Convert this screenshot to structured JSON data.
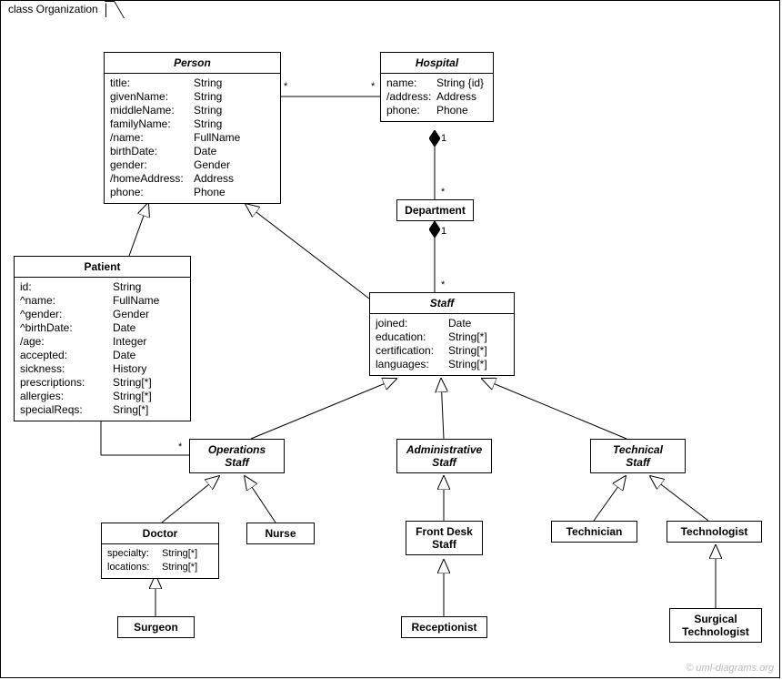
{
  "frameTitle": "class Organization",
  "watermark": "© uml-diagrams.org",
  "classes": {
    "person": {
      "title": "Person",
      "attrs": [
        {
          "n": "title:",
          "t": "String"
        },
        {
          "n": "givenName:",
          "t": "String"
        },
        {
          "n": "middleName:",
          "t": "String"
        },
        {
          "n": "familyName:",
          "t": "String"
        },
        {
          "n": "/name:",
          "t": "FullName"
        },
        {
          "n": "birthDate:",
          "t": "Date"
        },
        {
          "n": "gender:",
          "t": "Gender"
        },
        {
          "n": "/homeAddress:",
          "t": "Address"
        },
        {
          "n": "phone:",
          "t": "Phone"
        }
      ]
    },
    "hospital": {
      "title": "Hospital",
      "attrs": [
        {
          "n": "name:",
          "t": "String {id}"
        },
        {
          "n": "/address:",
          "t": "Address"
        },
        {
          "n": "phone:",
          "t": "Phone"
        }
      ]
    },
    "department": {
      "title": "Department"
    },
    "patient": {
      "title": "Patient",
      "attrs": [
        {
          "n": "id:",
          "t": "String"
        },
        {
          "n": "^name:",
          "t": "FullName"
        },
        {
          "n": "^gender:",
          "t": "Gender"
        },
        {
          "n": "^birthDate:",
          "t": "Date"
        },
        {
          "n": "/age:",
          "t": "Integer"
        },
        {
          "n": "accepted:",
          "t": "Date"
        },
        {
          "n": "sickness:",
          "t": "History"
        },
        {
          "n": "prescriptions:",
          "t": "String[*]"
        },
        {
          "n": "allergies:",
          "t": "String[*]"
        },
        {
          "n": "specialReqs:",
          "t": "Sring[*]"
        }
      ]
    },
    "staff": {
      "title": "Staff",
      "attrs": [
        {
          "n": "joined:",
          "t": "Date"
        },
        {
          "n": "education:",
          "t": "String[*]"
        },
        {
          "n": "certification:",
          "t": "String[*]"
        },
        {
          "n": "languages:",
          "t": "String[*]"
        }
      ]
    },
    "opsStaff": {
      "title": "Operations\nStaff"
    },
    "adminStaff": {
      "title": "Administrative\nStaff"
    },
    "techStaff": {
      "title": "Technical\nStaff"
    },
    "doctor": {
      "title": "Doctor",
      "attrs": [
        {
          "n": "specialty:",
          "t": "String[*]"
        },
        {
          "n": "locations:",
          "t": "String[*]"
        }
      ]
    },
    "nurse": {
      "title": "Nurse"
    },
    "frontDesk": {
      "title": "Front Desk\nStaff"
    },
    "receptionist": {
      "title": "Receptionist"
    },
    "technician": {
      "title": "Technician"
    },
    "technologist": {
      "title": "Technologist"
    },
    "surgTech": {
      "title": "Surgical\nTechnologist"
    }
  },
  "mults": {
    "personHosp_p": "*",
    "personHosp_h": "*",
    "hospDept_h": "1",
    "hospDept_d": "*",
    "deptStaff_d": "1",
    "deptStaff_s": "*",
    "patOps_p": "*",
    "patOps_o": "*"
  }
}
